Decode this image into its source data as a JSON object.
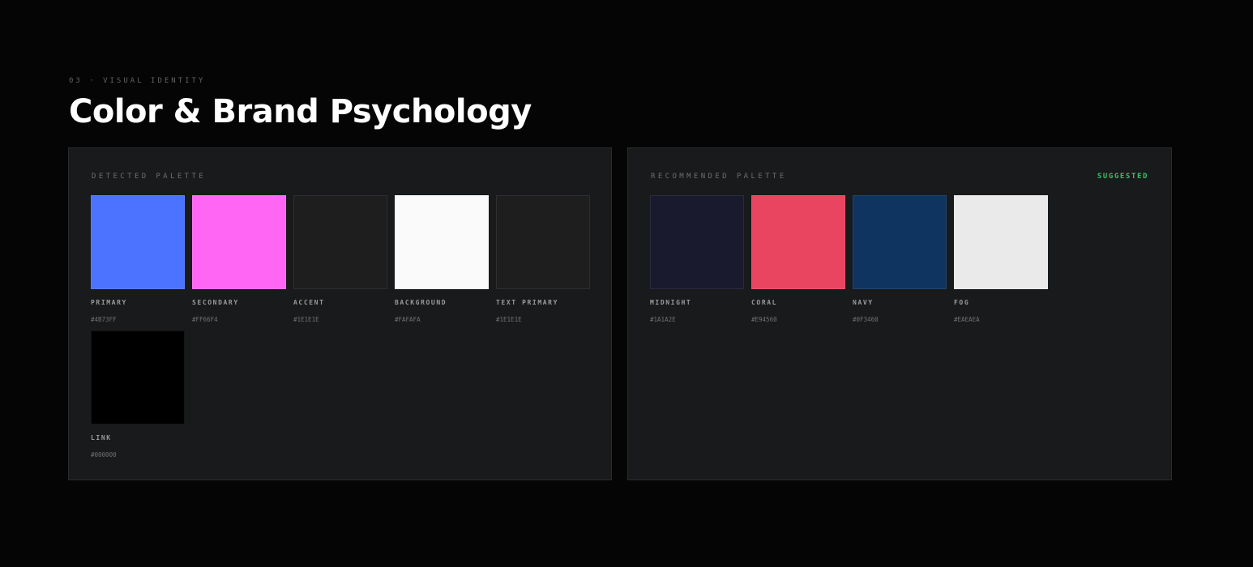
{
  "section": {
    "eyebrow": "03 · VISUAL IDENTITY",
    "title": "Color & Brand Psychology"
  },
  "detected": {
    "label": "DETECTED PALETTE",
    "swatches": [
      {
        "name": "PRIMARY",
        "hex": "#4B73FF",
        "color": "#4b73ff"
      },
      {
        "name": "SECONDARY",
        "hex": "#FF66F4",
        "color": "#ff66f4"
      },
      {
        "name": "ACCENT",
        "hex": "#1E1E1E",
        "color": "#1e1e1e"
      },
      {
        "name": "BACKGROUND",
        "hex": "#FAFAFA",
        "color": "#fafafa"
      },
      {
        "name": "TEXT PRIMARY",
        "hex": "#1E1E1E",
        "color": "#1e1e1e"
      },
      {
        "name": "LINK",
        "hex": "#000000",
        "color": "#000000"
      }
    ]
  },
  "recommended": {
    "label": "RECOMMENDED PALETTE",
    "tag": "SUGGESTED",
    "swatches": [
      {
        "name": "MIDNIGHT",
        "hex": "#1A1A2E",
        "color": "#1a1a2e"
      },
      {
        "name": "CORAL",
        "hex": "#E94560",
        "color": "#e94560"
      },
      {
        "name": "NAVY",
        "hex": "#0F3460",
        "color": "#0f3460"
      },
      {
        "name": "FOG",
        "hex": "#EAEAEA",
        "color": "#eaeaea"
      }
    ]
  }
}
